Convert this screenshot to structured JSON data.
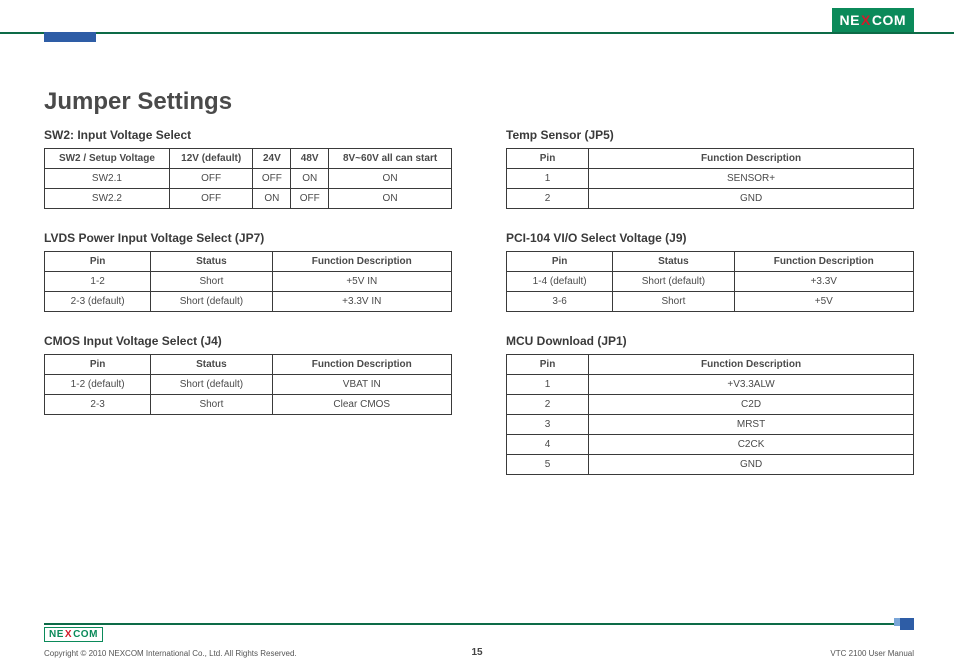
{
  "brand": {
    "pre": "NE",
    "x": "X",
    "post": "COM"
  },
  "title": "Jumper Settings",
  "left": [
    {
      "heading": "SW2: Input Voltage Select",
      "headers": [
        "SW2 / Setup Voltage",
        "12V (default)",
        "24V",
        "48V",
        "8V~60V all can start"
      ],
      "rows": [
        [
          "SW2.1",
          "OFF",
          "OFF",
          "ON",
          "ON"
        ],
        [
          "SW2.2",
          "OFF",
          "ON",
          "OFF",
          "ON"
        ]
      ]
    },
    {
      "heading": "LVDS Power Input Voltage Select (JP7)",
      "headers": [
        "Pin",
        "Status",
        "Function Description"
      ],
      "rows": [
        [
          "1-2",
          "Short",
          "+5V IN"
        ],
        [
          "2-3 (default)",
          "Short (default)",
          "+3.3V IN"
        ]
      ]
    },
    {
      "heading": "CMOS Input Voltage Select (J4)",
      "headers": [
        "Pin",
        "Status",
        "Function Description"
      ],
      "rows": [
        [
          "1-2 (default)",
          "Short (default)",
          "VBAT IN"
        ],
        [
          "2-3",
          "Short",
          "Clear CMOS"
        ]
      ]
    }
  ],
  "right": [
    {
      "heading": "Temp Sensor (JP5)",
      "headers": [
        "Pin",
        "Function Description"
      ],
      "rows": [
        [
          "1",
          "SENSOR+"
        ],
        [
          "2",
          "GND"
        ]
      ]
    },
    {
      "heading": "PCI-104 VI/O Select Voltage (J9)",
      "headers": [
        "Pin",
        "Status",
        "Function Description"
      ],
      "rows": [
        [
          "1-4 (default)",
          "Short (default)",
          "+3.3V"
        ],
        [
          "3-6",
          "Short",
          "+5V"
        ]
      ]
    },
    {
      "heading": "MCU Download (JP1)",
      "headers": [
        "Pin",
        "Function Description"
      ],
      "rows": [
        [
          "1",
          "+V3.3ALW"
        ],
        [
          "2",
          "C2D"
        ],
        [
          "3",
          "MRST"
        ],
        [
          "4",
          "C2CK"
        ],
        [
          "5",
          "GND"
        ]
      ]
    }
  ],
  "footer": {
    "copyright": "Copyright © 2010 NEXCOM International Co., Ltd. All Rights Reserved.",
    "page": "15",
    "manual": "VTC 2100 User Manual"
  }
}
